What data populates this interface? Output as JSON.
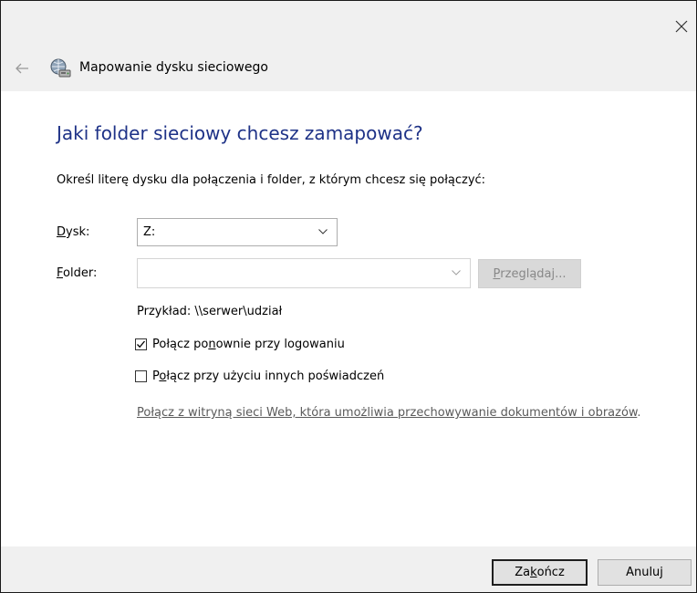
{
  "window": {
    "title": "Mapowanie dysku sieciowego",
    "close_icon": "close-icon",
    "back_icon": "back-arrow-icon",
    "app_icon": "network-drive-icon"
  },
  "page": {
    "heading": "Jaki folder sieciowy chcesz zamapować?",
    "instruction": "Określ literę dysku dla połączenia i folder, z którym chcesz się połączyć:"
  },
  "drive": {
    "label_mnemonic": "D",
    "label_rest": "ysk:",
    "value": "Z:"
  },
  "folder": {
    "label_mnemonic": "F",
    "label_rest": "older:",
    "value": "",
    "placeholder": "",
    "browse_mnemonic": "P",
    "browse_rest": "rzeglądaj..."
  },
  "example": "Przykład: \\\\serwer\\udział",
  "reconnect": {
    "checked": true,
    "label_a": "Połącz po",
    "label_mnemonic": "n",
    "label_b": "ownie przy logowaniu"
  },
  "credentials": {
    "checked": false,
    "label_a": "P",
    "label_mnemonic": "o",
    "label_b": "łącz przy użyciu innych poświadczeń"
  },
  "web_link": {
    "text": "Połącz z witryną sieci Web, która umożliwia przechowywanie dokumentów i obrazów",
    "suffix": "."
  },
  "footer": {
    "finish_a": "Za",
    "finish_mnemonic": "k",
    "finish_b": "ończ",
    "cancel": "Anuluj"
  },
  "colors": {
    "heading": "#1e3287",
    "titlebar_bg": "#f0f0f0",
    "link": "#5a5a5a"
  }
}
